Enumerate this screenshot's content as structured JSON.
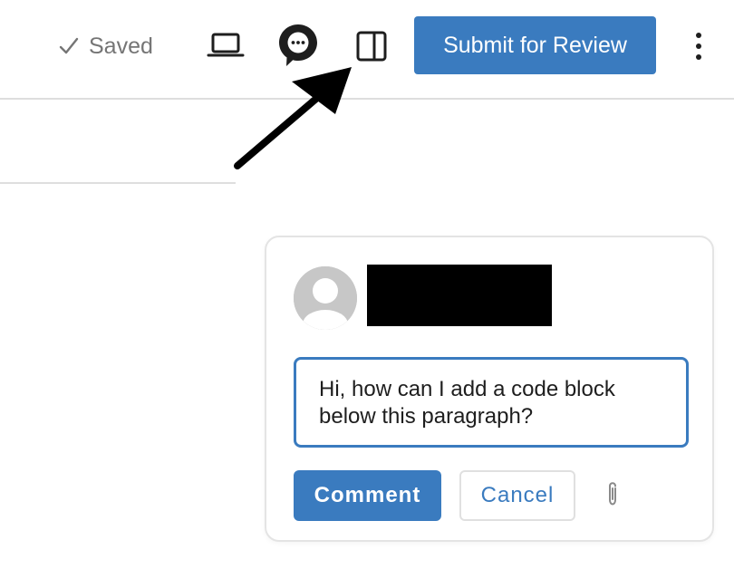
{
  "toolbar": {
    "saved_label": "Saved",
    "icons": {
      "saved": "check-icon",
      "preview": "laptop-icon",
      "comments": "comment-bubble-icon",
      "sidebar": "sidebar-toggle-icon",
      "more": "more-vertical-icon"
    },
    "submit_label": "Submit for Review"
  },
  "comment_form": {
    "icons": {
      "avatar": "user-avatar-icon",
      "attach": "paperclip-icon"
    },
    "input_value": "Hi, how can I add a code block below this paragraph?",
    "comment_label": "Comment",
    "cancel_label": "Cancel"
  },
  "annotation": {
    "icon": "arrow-annotation-icon"
  },
  "colors": {
    "accent": "#3a7bbf",
    "text_muted": "#757575",
    "border": "#e4e4e4",
    "dark": "#1e1e1e"
  }
}
